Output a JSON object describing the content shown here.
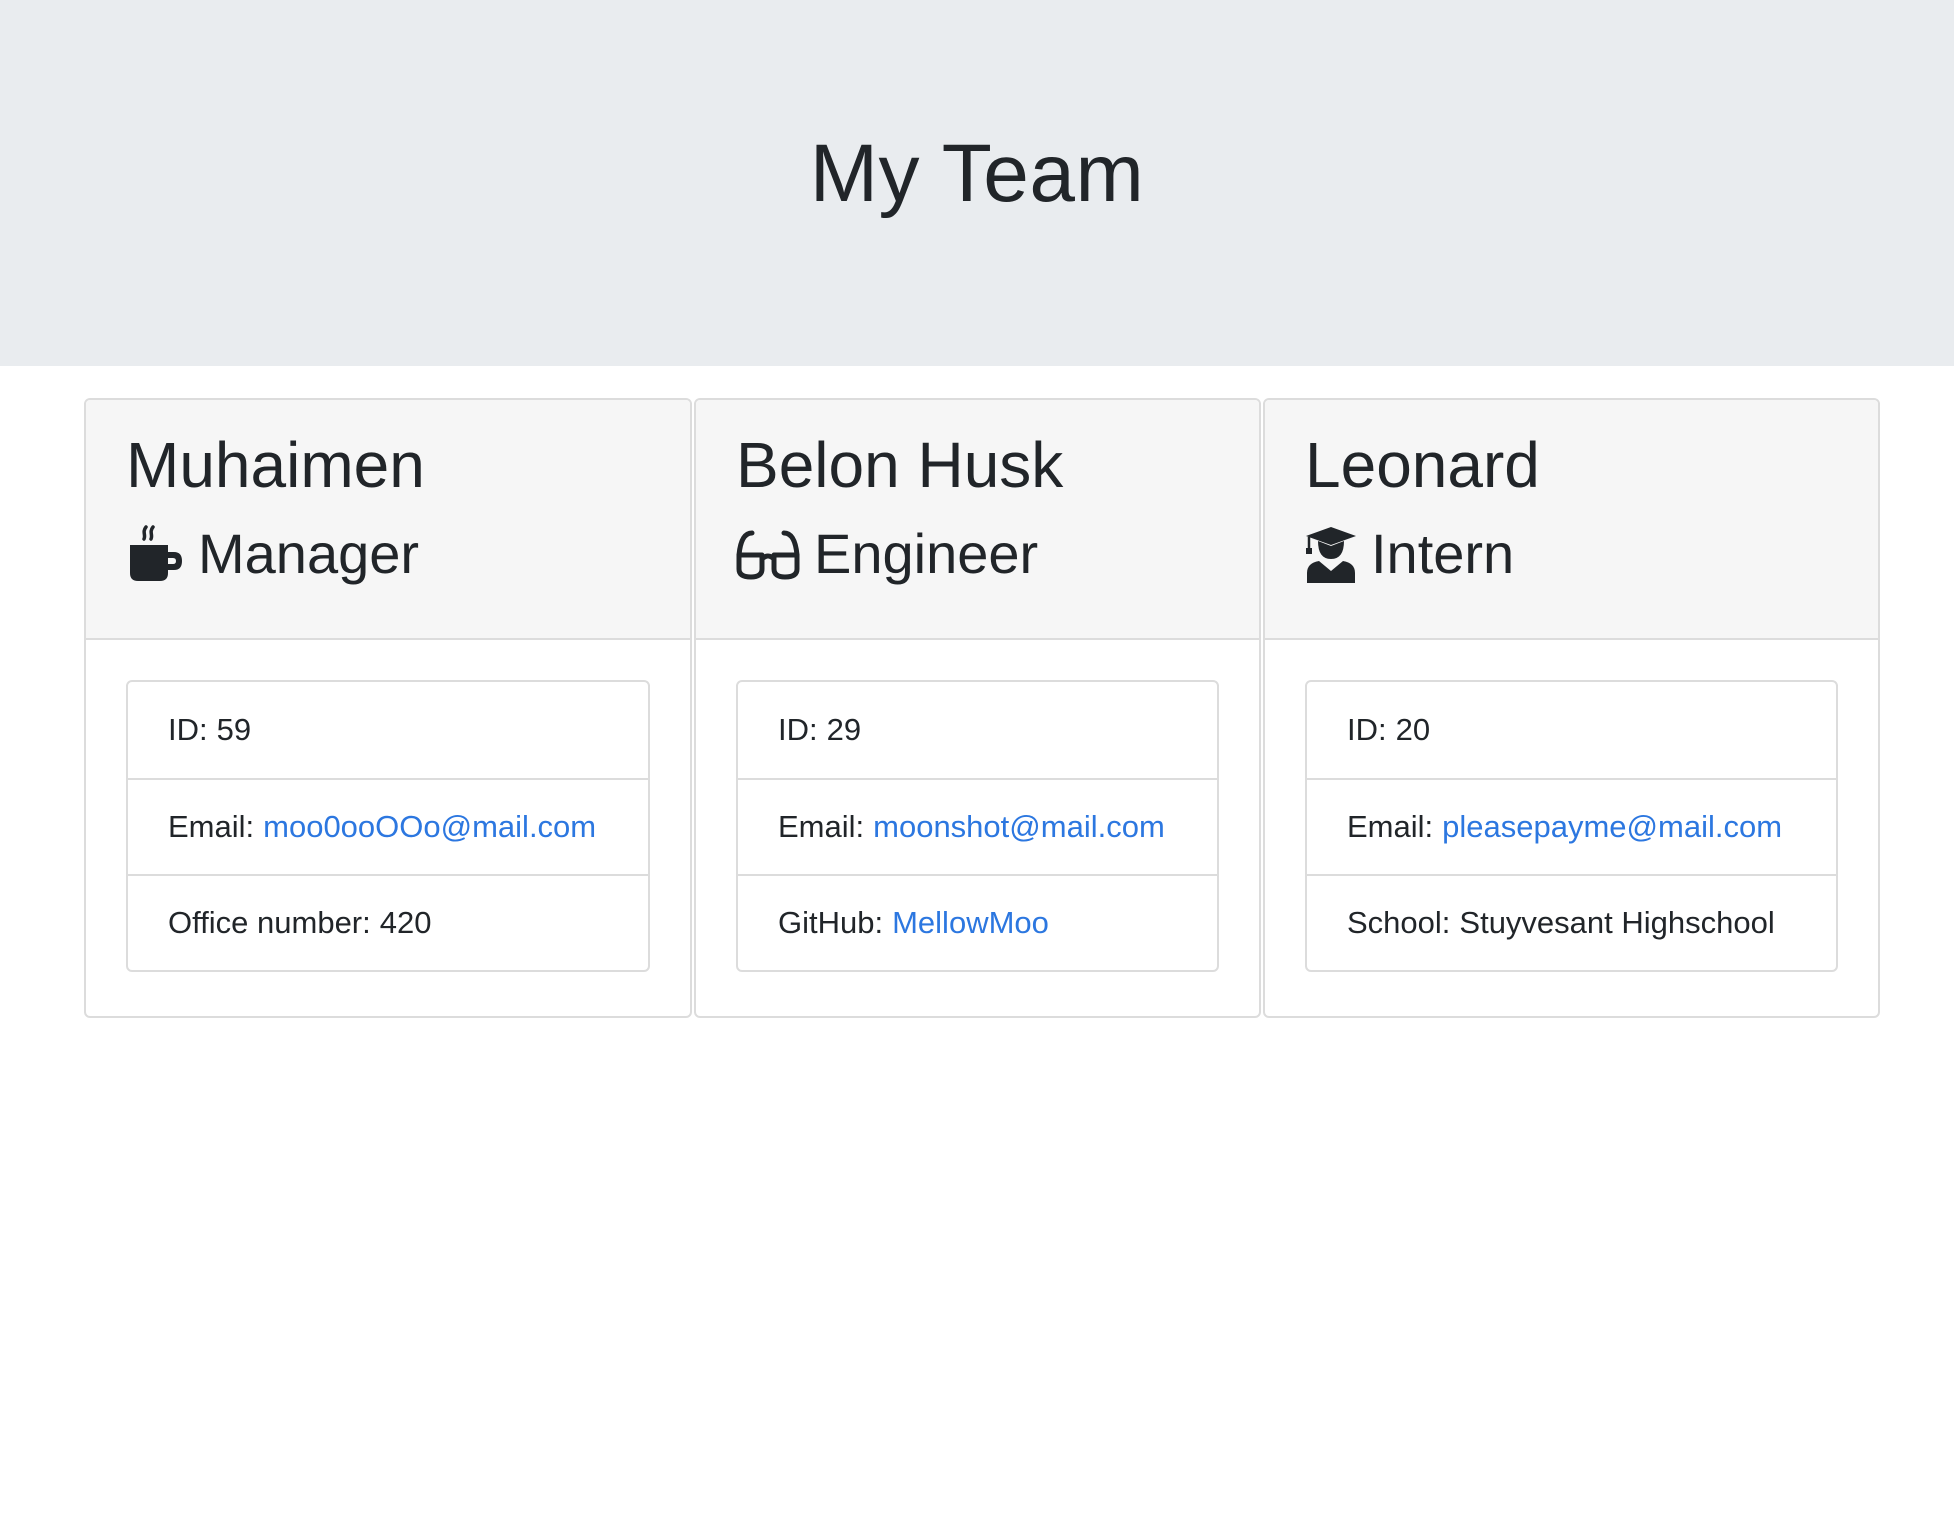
{
  "header": {
    "title": "My Team"
  },
  "team": [
    {
      "name": "Muhaimen",
      "role": "Manager",
      "icon": "mug-hot-icon",
      "id_label": "ID:",
      "id": "59",
      "email_label": "Email:",
      "email": "moo0ooOOo@mail.com",
      "extra_label": "Office number:",
      "extra_value": "420"
    },
    {
      "name": "Belon Husk",
      "role": "Engineer",
      "icon": "glasses-icon",
      "id_label": "ID:",
      "id": "29",
      "email_label": "Email:",
      "email": "moonshot@mail.com",
      "extra_label": "GitHub:",
      "extra_value": "MellowMoo"
    },
    {
      "name": "Leonard",
      "role": "Intern",
      "icon": "user-graduate-icon",
      "id_label": "ID:",
      "id": "20",
      "email_label": "Email:",
      "email": "pleasepayme@mail.com",
      "extra_label": "School:",
      "extra_value": "Stuyvesant Highschool"
    }
  ],
  "colors": {
    "header_bg": "#e9ecef",
    "card_header_bg": "#f6f6f6",
    "link": "#2c77e0",
    "text": "#212529"
  }
}
